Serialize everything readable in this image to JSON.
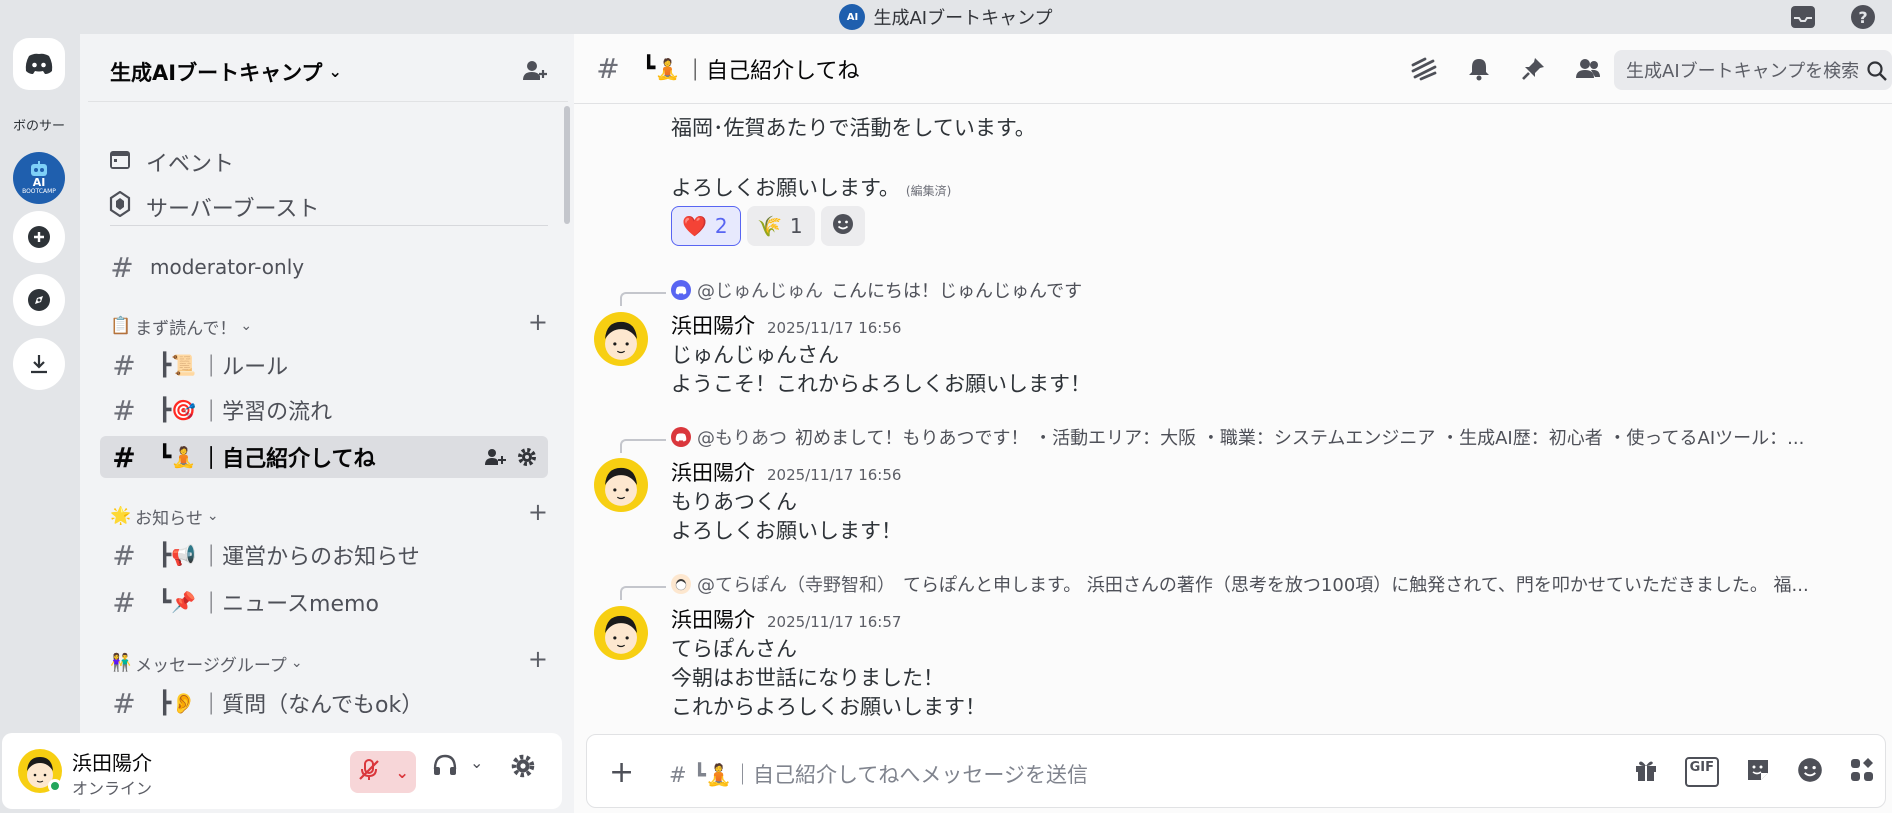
{
  "titlebar": {
    "title": "生成AIブートキャンプ",
    "server_mini": "AI"
  },
  "rail": {
    "partial_server_label": "ボのサー",
    "ai_server_label": "AI",
    "ai_server_sub": "BOOTCAMP"
  },
  "sidebar": {
    "server_name": "生成AIブートキャンプ",
    "items": [
      {
        "label": "イベント",
        "icon": "calendar-icon"
      },
      {
        "label": "サーバーブースト",
        "icon": "boost-icon"
      }
    ],
    "moderator_channel": "moderator-only",
    "categories": [
      {
        "label": "まず読んで！",
        "emoji": "📋",
        "channels": [
          {
            "prefix": "┣",
            "emoji": "📜",
            "label": "｜ルール"
          },
          {
            "prefix": "┣",
            "emoji": "🎯",
            "label": "｜学習の流れ"
          },
          {
            "prefix": "┗",
            "emoji": "🧘",
            "label": "｜自己紹介してね",
            "active": true
          }
        ]
      },
      {
        "label": "お知らせ",
        "emoji": "🌟",
        "channels": [
          {
            "prefix": "┣",
            "emoji": "📢",
            "label": "｜運営からのお知らせ"
          },
          {
            "prefix": "┗",
            "emoji": "📌",
            "label": "｜ニュースmemo"
          }
        ]
      },
      {
        "label": "メッセージグループ",
        "emoji": "👫",
        "channels": [
          {
            "prefix": "┣",
            "emoji": "👂",
            "label": "｜質問（なんでもok）"
          }
        ]
      }
    ]
  },
  "user": {
    "name": "浜田陽介",
    "status": "オンライン"
  },
  "header": {
    "channel_prefix": "┗",
    "channel_emoji": "🧘",
    "channel_name": "｜自己紹介してね",
    "search_placeholder": "生成AIブートキャンプを検索"
  },
  "messages": {
    "top_line1": "福岡･佐賀あたりで活動をしています。",
    "top_line2": "よろしくお願いします。",
    "edited": "(編集済)",
    "reactions": [
      {
        "emoji": "❤️",
        "count": "2"
      },
      {
        "emoji": "🌾",
        "count": "1"
      }
    ],
    "replies": [
      {
        "reply_name": "@じゅんじゅん",
        "reply_text": "こんにちは！じゅんじゅんです",
        "author": "浜田陽介",
        "time": "2025/11/17 16:56",
        "lines": [
          "じゅんじゅんさん",
          "ようこそ！これからよろしくお願いします！"
        ]
      },
      {
        "reply_name": "@もりあつ",
        "reply_text": "初めまして！もりあつです！ ・活動エリア：大阪 ・職業：システムエンジニア ・生成AI歴：初心者 ・使ってるAIツール：...",
        "author": "浜田陽介",
        "time": "2025/11/17 16:56",
        "lines": [
          "もりあつくん",
          "よろしくお願いします！"
        ]
      },
      {
        "reply_name": "@てらぽん（寺野智和）",
        "reply_text": "てらぽんと申します。 浜田さんの著作（思考を放つ100項）に触発されて、門を叩かせていただきました。 福...",
        "author": "浜田陽介",
        "time": "2025/11/17 16:57",
        "lines": [
          "てらぽんさん",
          "今朝はお世話になりました！",
          "これからよろしくお願いします！"
        ]
      }
    ]
  },
  "composer": {
    "placeholder": "# ┗🧘｜自己紹介してねへメッセージを送信",
    "gif_label": "GIF"
  },
  "colors": {
    "accent": "#5865f2",
    "online": "#23a55a",
    "mute": "#da373c",
    "avatar_yellow": "#f7cf12"
  }
}
